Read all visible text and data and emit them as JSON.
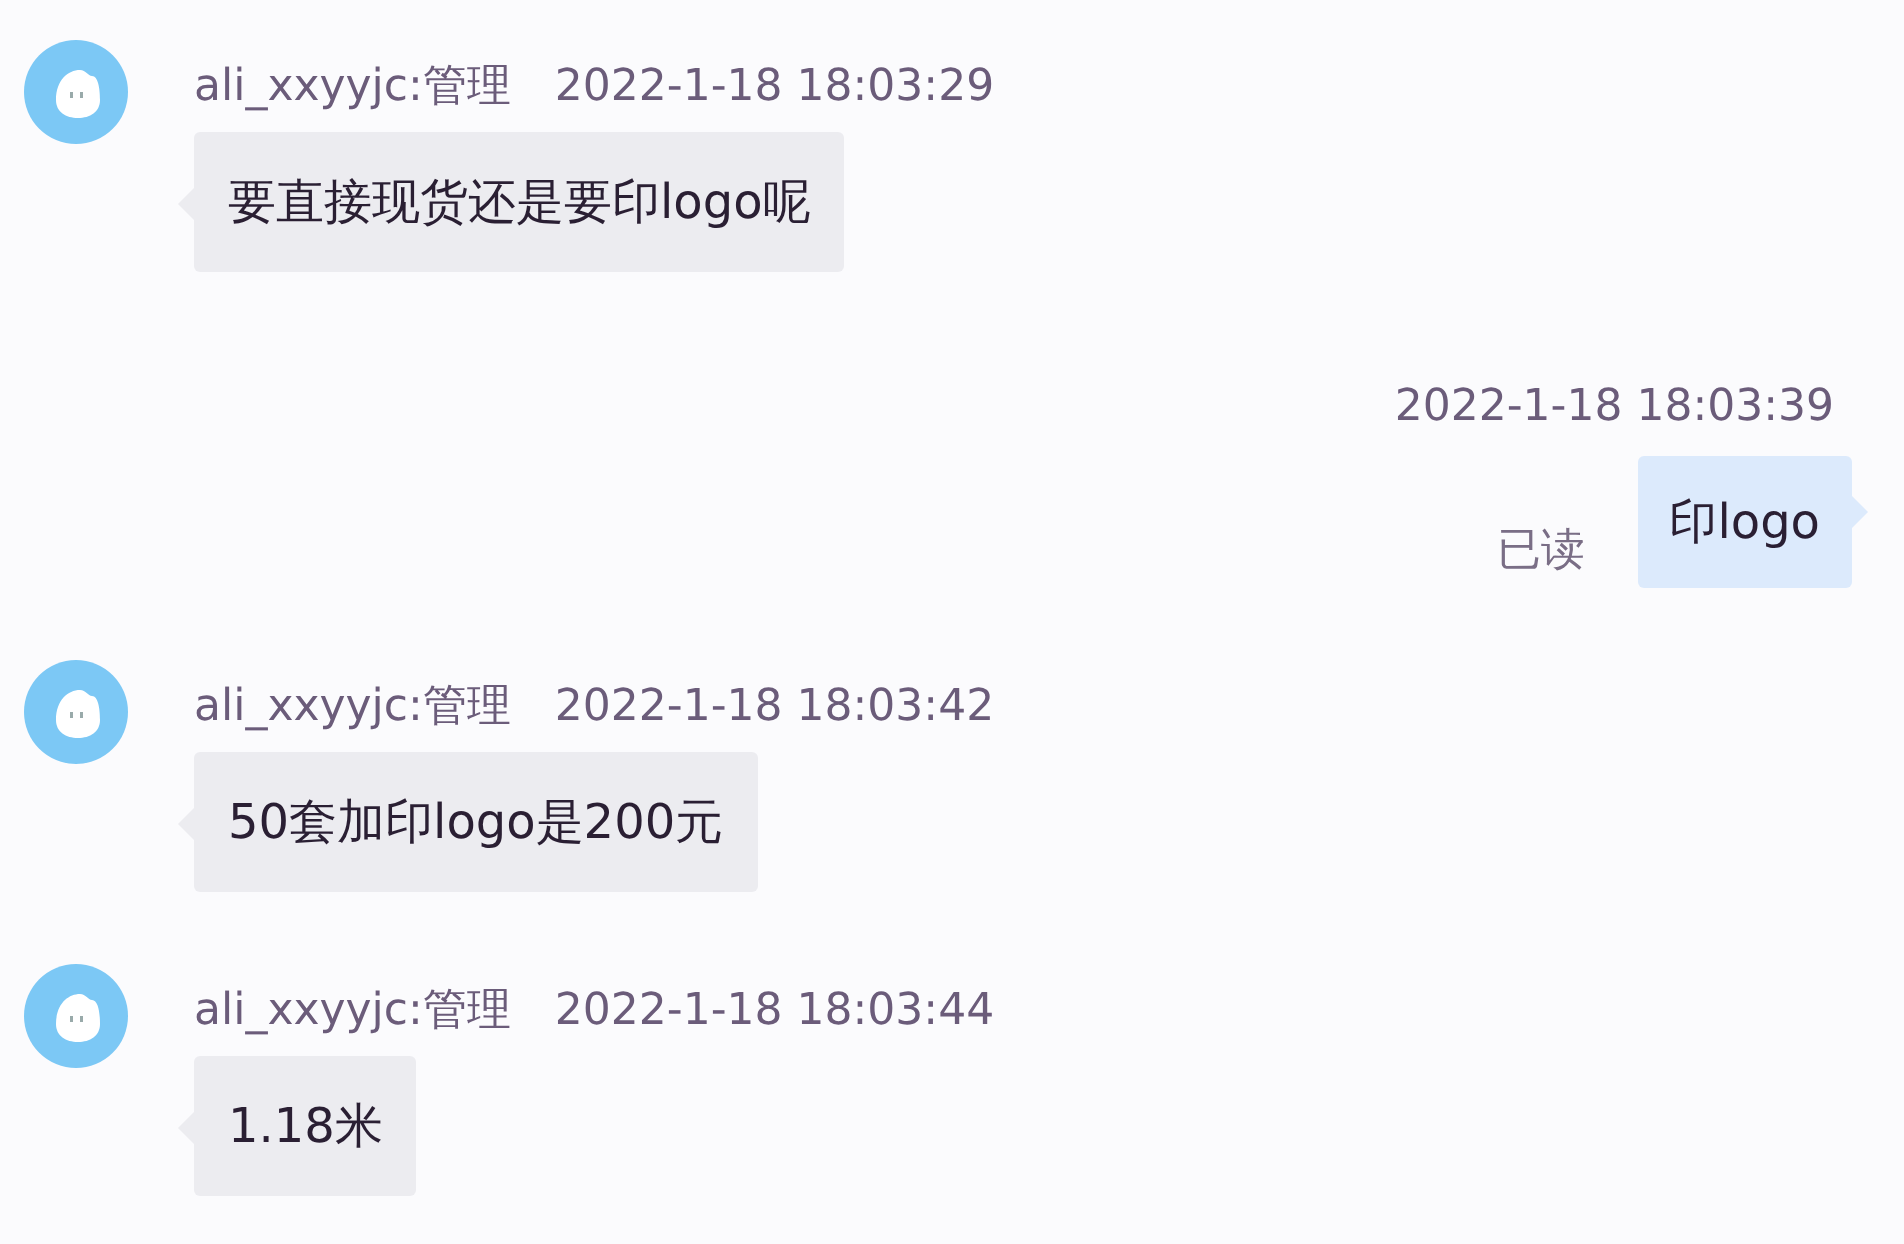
{
  "messages": [
    {
      "kind": "incoming",
      "sender": "ali_xxyyjc:管理",
      "time": "2022-1-18 18:03:29",
      "text": "要直接现货还是要印logo呢"
    },
    {
      "kind": "outgoing",
      "time": "2022-1-18 18:03:39",
      "text": "印logo",
      "status": "已读"
    },
    {
      "kind": "incoming",
      "sender": "ali_xxyyjc:管理",
      "time": "2022-1-18 18:03:42",
      "text": "50套加印logo是200元"
    },
    {
      "kind": "incoming",
      "sender": "ali_xxyyjc:管理",
      "time": "2022-1-18 18:03:44",
      "text": "1.18米"
    }
  ]
}
